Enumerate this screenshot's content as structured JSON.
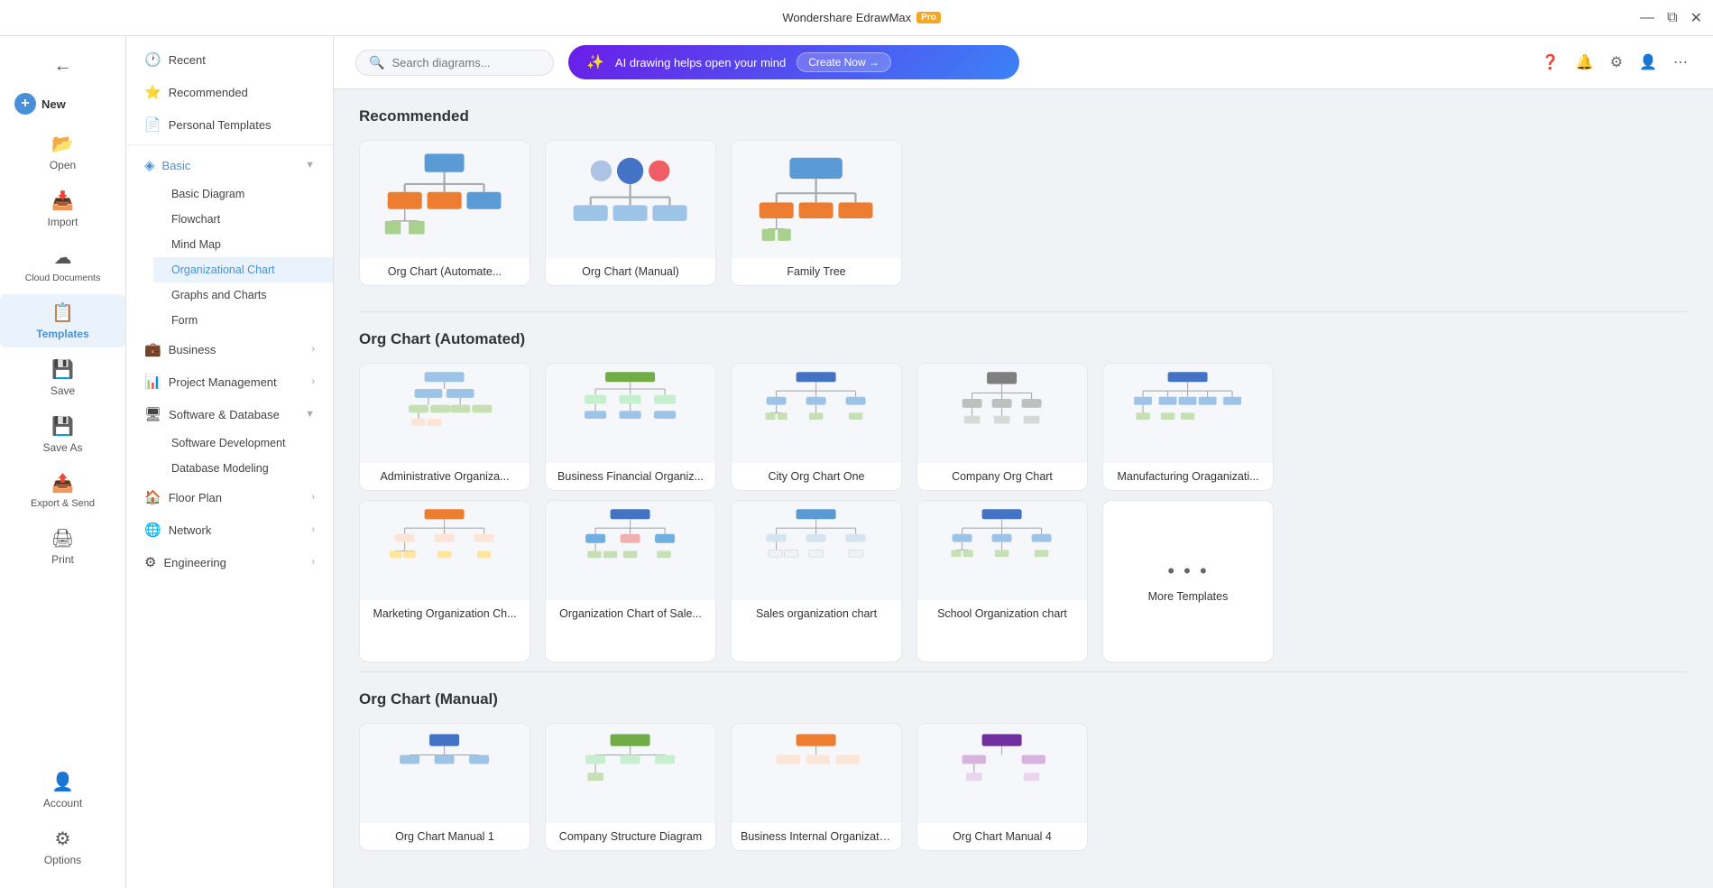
{
  "app": {
    "title": "Wondershare EdrawMax",
    "pro_badge": "Pro"
  },
  "titlebar": {
    "minimize": "—",
    "restore": "⧉",
    "close": "✕"
  },
  "sidebar": {
    "items": [
      {
        "id": "new",
        "label": "New",
        "icon": "+"
      },
      {
        "id": "open",
        "label": "Open",
        "icon": "📂"
      },
      {
        "id": "import",
        "label": "Import",
        "icon": "📥"
      },
      {
        "id": "cloud",
        "label": "Cloud Documents",
        "icon": "☁"
      },
      {
        "id": "templates",
        "label": "Templates",
        "icon": "📋"
      },
      {
        "id": "save",
        "label": "Save",
        "icon": "💾"
      },
      {
        "id": "saveas",
        "label": "Save As",
        "icon": "💾"
      },
      {
        "id": "export",
        "label": "Export & Send",
        "icon": "📤"
      },
      {
        "id": "print",
        "label": "Print",
        "icon": "🖨"
      }
    ],
    "bottom": [
      {
        "id": "account",
        "label": "Account",
        "icon": "👤"
      },
      {
        "id": "options",
        "label": "Options",
        "icon": "⚙"
      }
    ]
  },
  "nav": {
    "items": [
      {
        "id": "recent",
        "label": "Recent",
        "icon": "🕐"
      },
      {
        "id": "recommended",
        "label": "Recommended",
        "icon": "⭐"
      },
      {
        "id": "personal",
        "label": "Personal Templates",
        "icon": "📄"
      }
    ],
    "categories": [
      {
        "id": "basic",
        "label": "Basic",
        "expanded": true,
        "active": false,
        "children": [
          "Basic Diagram",
          "Flowchart",
          "Mind Map",
          "Organizational Chart",
          "Graphs and Charts",
          "Form"
        ]
      },
      {
        "id": "business",
        "label": "Business",
        "expanded": false
      },
      {
        "id": "project",
        "label": "Project Management",
        "expanded": false
      },
      {
        "id": "software",
        "label": "Software & Database",
        "expanded": true,
        "children": [
          "Software Development",
          "Database Modeling"
        ]
      },
      {
        "id": "floorplan",
        "label": "Floor Plan",
        "expanded": false
      },
      {
        "id": "network",
        "label": "Network",
        "expanded": false
      },
      {
        "id": "engineering",
        "label": "Engineering",
        "expanded": false
      }
    ]
  },
  "topbar": {
    "search_placeholder": "Search diagrams...",
    "ai_text": "AI drawing helps open your mind",
    "ai_btn": "Create Now →"
  },
  "recommended_section": {
    "title": "Recommended",
    "cards": [
      {
        "id": "org-auto",
        "label": "Org Chart (Automate..."
      },
      {
        "id": "org-manual",
        "label": "Org Chart (Manual)"
      },
      {
        "id": "family-tree",
        "label": "Family Tree"
      }
    ]
  },
  "org_automated_section": {
    "title": "Org Chart (Automated)",
    "cards": [
      {
        "id": "admin-org",
        "label": "Administrative Organiza..."
      },
      {
        "id": "biz-financial",
        "label": "Business Financial Organiz..."
      },
      {
        "id": "city-org",
        "label": "City Org Chart One"
      },
      {
        "id": "company-org",
        "label": "Company Org Chart"
      },
      {
        "id": "manufacturing",
        "label": "Manufacturing Oraganizati..."
      }
    ],
    "row2": [
      {
        "id": "marketing-org",
        "label": "Marketing Organization Ch..."
      },
      {
        "id": "org-sales",
        "label": "Organization Chart of Sale..."
      },
      {
        "id": "sales-org",
        "label": "Sales organization chart"
      },
      {
        "id": "school-org",
        "label": "School Organization chart"
      }
    ],
    "more": "More Templates"
  },
  "org_manual_section": {
    "title": "Org Chart (Manual)"
  }
}
